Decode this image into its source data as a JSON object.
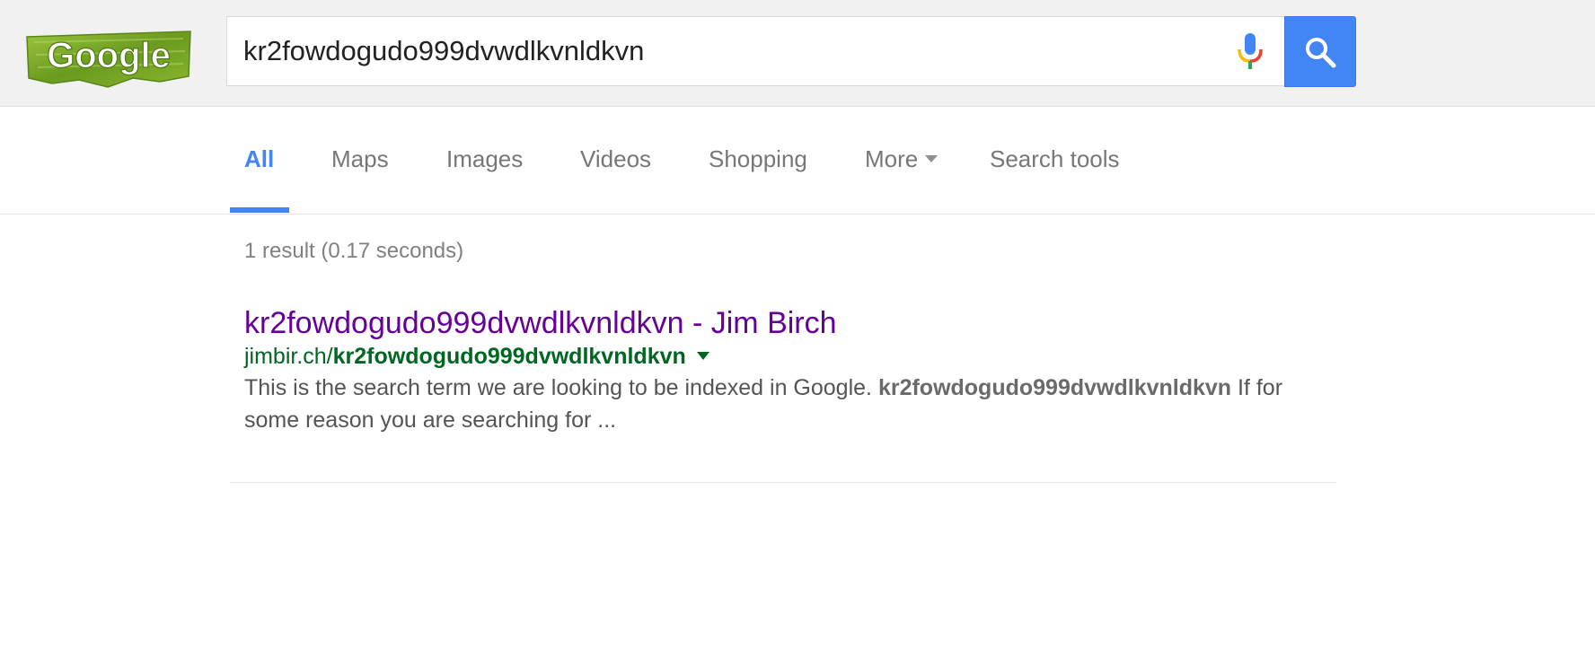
{
  "logo": {
    "text": "Google"
  },
  "search": {
    "query": "kr2fowdogudo999dvwdlkvnldkvn",
    "mic_icon": "microphone-icon",
    "button_icon": "magnifier-icon"
  },
  "tabs": [
    {
      "label": "All",
      "active": true
    },
    {
      "label": "Maps"
    },
    {
      "label": "Images"
    },
    {
      "label": "Videos"
    },
    {
      "label": "Shopping"
    },
    {
      "label": "More"
    },
    {
      "label": "Search tools"
    }
  ],
  "stats": "1 result (0.17 seconds)",
  "results": [
    {
      "title": "kr2fowdogudo999dvwdlkvnldkvn - Jim Birch",
      "url_prefix": "jimbir.ch/",
      "url_bold": "kr2fowdogudo999dvwdlkvnldkvn",
      "snippet_before": "This is the search term we are looking to be indexed in Google. ",
      "snippet_bold": "kr2fowdogudo999dvwdlkvnldkvn",
      "snippet_after": " If for some reason you are searching for ..."
    }
  ],
  "colors": {
    "accent": "#4285f4",
    "visited_link": "#660099",
    "url_green": "#006621"
  }
}
